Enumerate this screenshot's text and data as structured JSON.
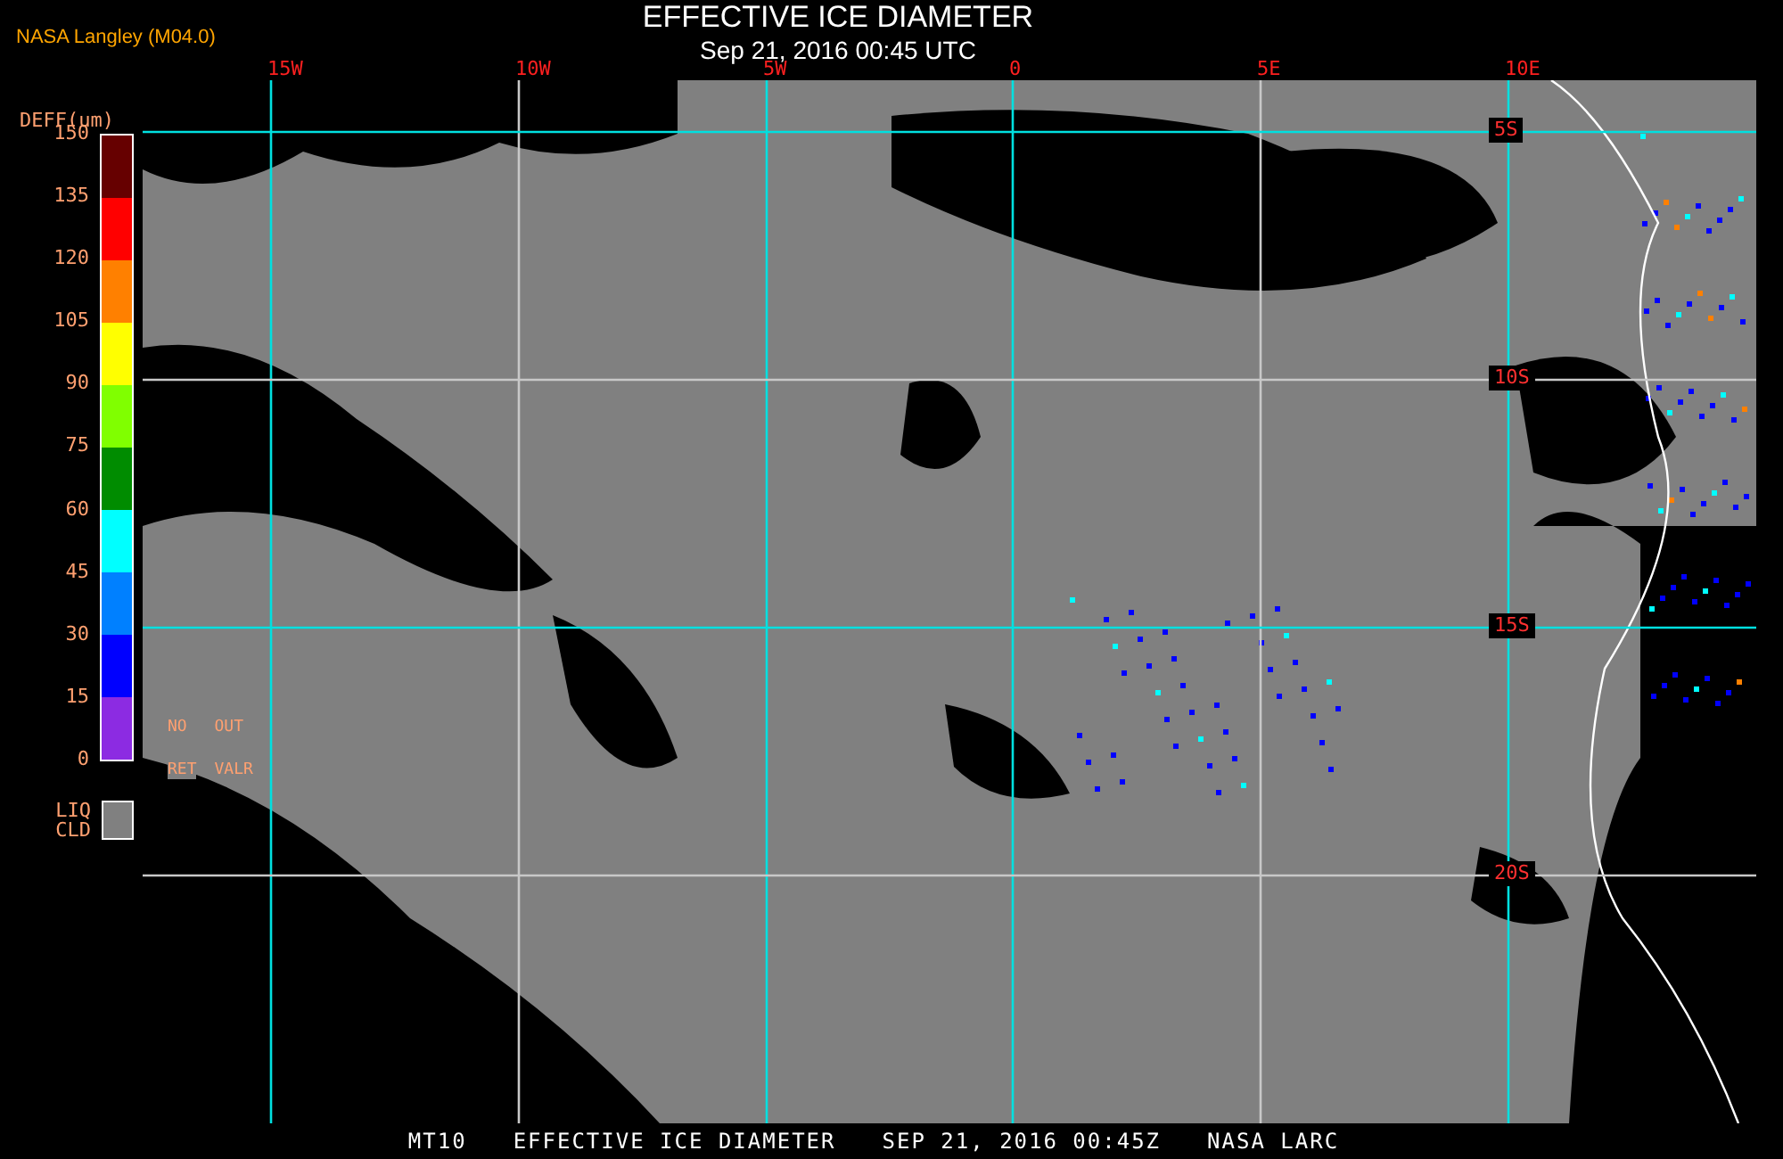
{
  "source": "NASA Langley (M04.0)",
  "title": "EFFECTIVE ICE DIAMETER",
  "subtitle": "Sep 21, 2016 00:45 UTC",
  "legend": {
    "title": "DEFF(um)",
    "ticks": [
      "150",
      "135",
      "120",
      "105",
      "90",
      "75",
      "60",
      "45",
      "30",
      "15",
      "0"
    ],
    "bins": [
      {
        "color": "#660000"
      },
      {
        "color": "#ff0000"
      },
      {
        "color": "#ff8000"
      },
      {
        "color": "#ffff00"
      },
      {
        "color": "#80ff00"
      },
      {
        "color": "#008c00"
      },
      {
        "color": "#00ffff"
      },
      {
        "color": "#0080ff"
      },
      {
        "color": "#0000ff"
      },
      {
        "color": "#8c2be2"
      }
    ],
    "no_retrieval": [
      "NO",
      "RET"
    ],
    "out_of_range": [
      "OUT",
      "VALR"
    ],
    "liquid_cloud": {
      "label": [
        "LIQ",
        "CLD"
      ],
      "color": "#808080"
    }
  },
  "map": {
    "lon_labels": [
      "15W",
      "10W",
      "5W",
      "0",
      "5E",
      "10E"
    ],
    "lat_labels": [
      "5S",
      "10S",
      "15S",
      "20S"
    ]
  },
  "footer": [
    "MT10",
    "EFFECTIVE ICE DIAMETER",
    "SEP 21, 2016 00:45Z",
    "NASA LARC"
  ]
}
